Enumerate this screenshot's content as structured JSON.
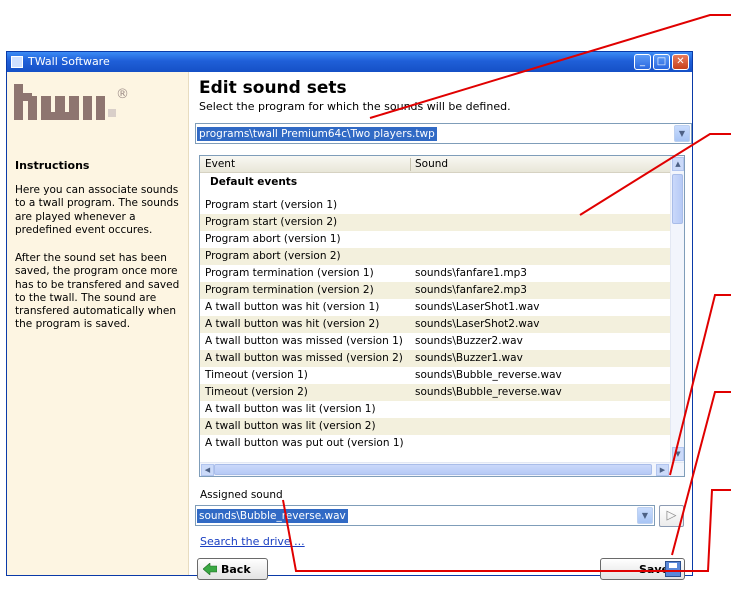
{
  "window": {
    "title": "TWall Software",
    "controls": {
      "minimize": "_",
      "maximize": "□",
      "close": "✕"
    }
  },
  "sidebar": {
    "logo_text": "twall",
    "logo_mark": "®",
    "instructions_title": "Instructions",
    "paragraph1": "Here you can associate sounds to a twall program. The sounds are played whenever a predefined event occures.",
    "paragraph2": "After the sound set has been saved, the program once more has to be transfered and saved to the twall. The sound are transfered automatically when the program is saved."
  },
  "main": {
    "heading": "Edit sound sets",
    "subtitle": "Select the program for which the sounds will be defined.",
    "program_select": {
      "value": "programs\\twall Premium64c\\Two players.twp",
      "arrow_icon": "chevron-down-icon"
    },
    "grid": {
      "columns": [
        "Event",
        "Sound"
      ],
      "group": "Default events",
      "rows": [
        {
          "event": "Program start (version 1)",
          "sound": ""
        },
        {
          "event": "Program start (version 2)",
          "sound": ""
        },
        {
          "event": "Program abort (version 1)",
          "sound": ""
        },
        {
          "event": "Program abort (version 2)",
          "sound": ""
        },
        {
          "event": "Program termination (version 1)",
          "sound": "sounds\\fanfare1.mp3"
        },
        {
          "event": "Program termination (version 2)",
          "sound": "sounds\\fanfare2.mp3"
        },
        {
          "event": "A twall button was hit (version 1)",
          "sound": "sounds\\LaserShot1.wav"
        },
        {
          "event": "A twall button was hit (version 2)",
          "sound": "sounds\\LaserShot2.wav"
        },
        {
          "event": "A twall button was missed (version 1)",
          "sound": "sounds\\Buzzer2.wav"
        },
        {
          "event": "A twall button was missed (version 2)",
          "sound": "sounds\\Buzzer1.wav"
        },
        {
          "event": "Timeout (version 1)",
          "sound": "sounds\\Bubble_reverse.wav"
        },
        {
          "event": "Timeout (version 2)",
          "sound": "sounds\\Bubble_reverse.wav"
        },
        {
          "event": "A twall button was lit (version 1)",
          "sound": ""
        },
        {
          "event": "A twall button was lit (version 2)",
          "sound": ""
        },
        {
          "event": "A twall button was put out (version 1)",
          "sound": ""
        }
      ]
    },
    "assigned_label": "Assigned sound",
    "assigned_select": {
      "value": "sounds\\Bubble_reverse.wav"
    },
    "play_icon": "play-icon",
    "search_link": "Search the drive ...",
    "back_button": "Back",
    "save_button": "Save"
  },
  "colors": {
    "title_bar": "#1f5fd8",
    "sidebar_bg": "#fdf5e2",
    "selection": "#316ac5",
    "alt_row": "#f3f0dd",
    "annotation": "#e00000",
    "logo": "#8e7570"
  }
}
